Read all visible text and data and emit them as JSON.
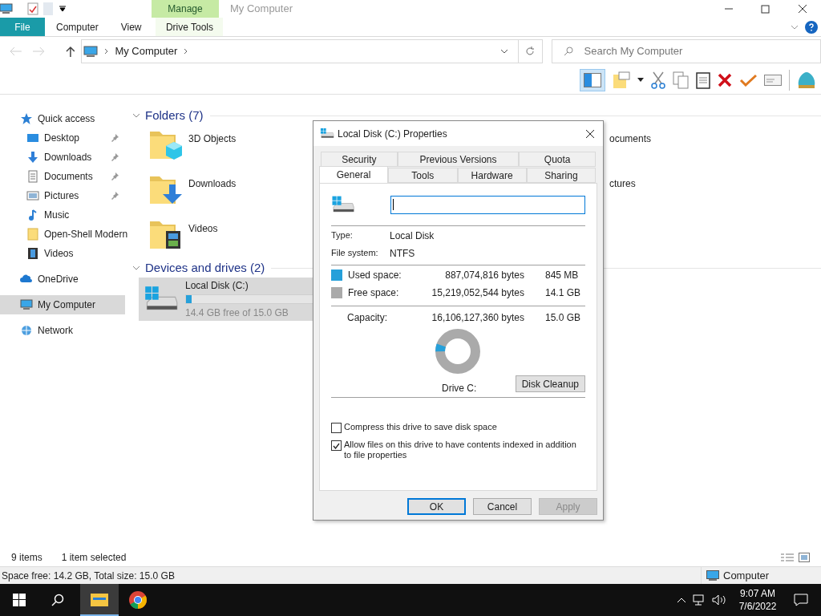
{
  "title_bar": {
    "context_tab": "Manage",
    "title": "My Computer"
  },
  "ribbon_tabs": [
    {
      "label": "File",
      "kind": "file"
    },
    {
      "label": "Computer",
      "kind": "normal"
    },
    {
      "label": "View",
      "kind": "normal"
    },
    {
      "label": "Drive Tools",
      "kind": "contextual"
    }
  ],
  "address": {
    "path": "My Computer"
  },
  "search": {
    "placeholder": "Search My Computer"
  },
  "sidebar": {
    "items": [
      {
        "label": "Quick access",
        "kind": "star",
        "selected": false,
        "children": [
          {
            "label": "Desktop",
            "kind": "desktop",
            "pinned": true,
            "selected": false
          },
          {
            "label": "Downloads",
            "kind": "download",
            "pinned": true,
            "selected": false
          },
          {
            "label": "Documents",
            "kind": "document",
            "pinned": true,
            "selected": false
          },
          {
            "label": "Pictures",
            "kind": "picture",
            "pinned": true,
            "selected": false
          },
          {
            "label": "Music",
            "kind": "music",
            "pinned": false,
            "selected": false
          },
          {
            "label": "Open-Shell Modern",
            "kind": "folder",
            "pinned": false,
            "selected": false
          },
          {
            "label": "Videos",
            "kind": "video",
            "pinned": false,
            "selected": false
          }
        ]
      },
      {
        "label": "OneDrive",
        "kind": "cloud",
        "selected": false
      },
      {
        "label": "My Computer",
        "kind": "computer",
        "selected": true
      },
      {
        "label": "Network",
        "kind": "network",
        "selected": false
      }
    ]
  },
  "folders": {
    "heading": "Folders (7)",
    "items": [
      {
        "label": "3D Objects",
        "kind": "cube"
      },
      {
        "label": "Downloads",
        "kind": "download"
      },
      {
        "label": "Videos",
        "kind": "video"
      }
    ],
    "partial_items": [
      "ocuments",
      "ctures"
    ]
  },
  "drives": {
    "heading": "Devices and drives (2)",
    "items": [
      {
        "label": "Local Disk (C:)",
        "level": 0.04,
        "detail": "14.4 GB free of 15.0 GB",
        "selected": true
      }
    ]
  },
  "status_bar": {
    "count": "9 items",
    "selection": "1 item selected"
  },
  "details_bar": {
    "text": "Space free: 14.2 GB, Total size: 15.0 GB",
    "location": "Computer"
  },
  "taskbar": {
    "time": "9:07 AM",
    "date": "7/6/2022"
  },
  "dialog": {
    "title": "Local Disk (C:) Properties",
    "tabs_back": [
      {
        "label": "Security",
        "selected": false
      },
      {
        "label": "Previous Versions",
        "selected": false
      },
      {
        "label": "Quota",
        "selected": false
      }
    ],
    "tabs_front": [
      {
        "label": "General",
        "selected": true
      },
      {
        "label": "Tools",
        "selected": false
      },
      {
        "label": "Hardware",
        "selected": false
      },
      {
        "label": "Sharing",
        "selected": false
      }
    ],
    "info": [
      {
        "label": "Type:",
        "value": "Local Disk"
      },
      {
        "label": "File system:",
        "value": "NTFS"
      }
    ],
    "space": [
      {
        "label": "Used space:",
        "bytes": "887,074,816 bytes",
        "size": "845 MB",
        "color": "#26a0da"
      },
      {
        "label": "Free space:",
        "bytes": "15,219,052,544 bytes",
        "size": "14.1 GB",
        "color": "#aaaaaa"
      }
    ],
    "capacity": {
      "label": "Capacity:",
      "bytes": "16,106,127,360 bytes",
      "size": "15.0 GB"
    },
    "drive_label": "Drive C:",
    "cleanup_button": "Disk Cleanup",
    "options": [
      {
        "label": "Compress this drive to save disk space",
        "checked": false
      },
      {
        "label": "Allow files on this drive to have contents indexed in addition to file properties",
        "checked": true
      }
    ],
    "buttons": [
      {
        "label": "OK",
        "kind": "default",
        "disabled": false
      },
      {
        "label": "Cancel",
        "kind": "normal",
        "disabled": false
      },
      {
        "label": "Apply",
        "kind": "normal",
        "disabled": true
      }
    ]
  }
}
